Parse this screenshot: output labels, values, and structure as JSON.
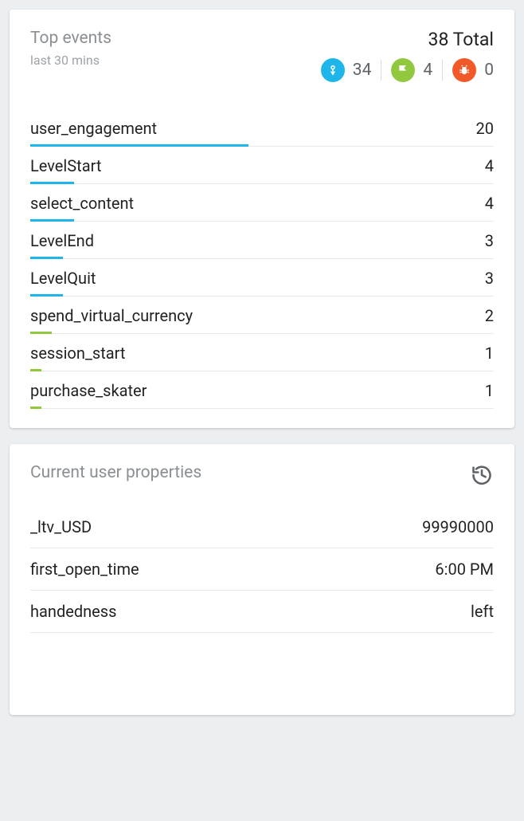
{
  "top_events": {
    "title": "Top events",
    "subtitle": "last 30 mins",
    "total_label": "38 Total",
    "stats": {
      "touch": 34,
      "flag": 4,
      "bug": 0
    },
    "max_value": 20,
    "events": [
      {
        "name": "user_engagement",
        "count": 20,
        "color": "blue"
      },
      {
        "name": "LevelStart",
        "count": 4,
        "color": "blue"
      },
      {
        "name": "select_content",
        "count": 4,
        "color": "blue"
      },
      {
        "name": "LevelEnd",
        "count": 3,
        "color": "blue"
      },
      {
        "name": "LevelQuit",
        "count": 3,
        "color": "blue"
      },
      {
        "name": "spend_virtual_currency",
        "count": 2,
        "color": "green"
      },
      {
        "name": "session_start",
        "count": 1,
        "color": "green"
      },
      {
        "name": "purchase_skater",
        "count": 1,
        "color": "green"
      }
    ]
  },
  "user_properties": {
    "title": "Current user properties",
    "props": [
      {
        "name": "_ltv_USD",
        "value": "99990000"
      },
      {
        "name": "first_open_time",
        "value": "6:00 PM"
      },
      {
        "name": "handedness",
        "value": "left"
      }
    ]
  }
}
